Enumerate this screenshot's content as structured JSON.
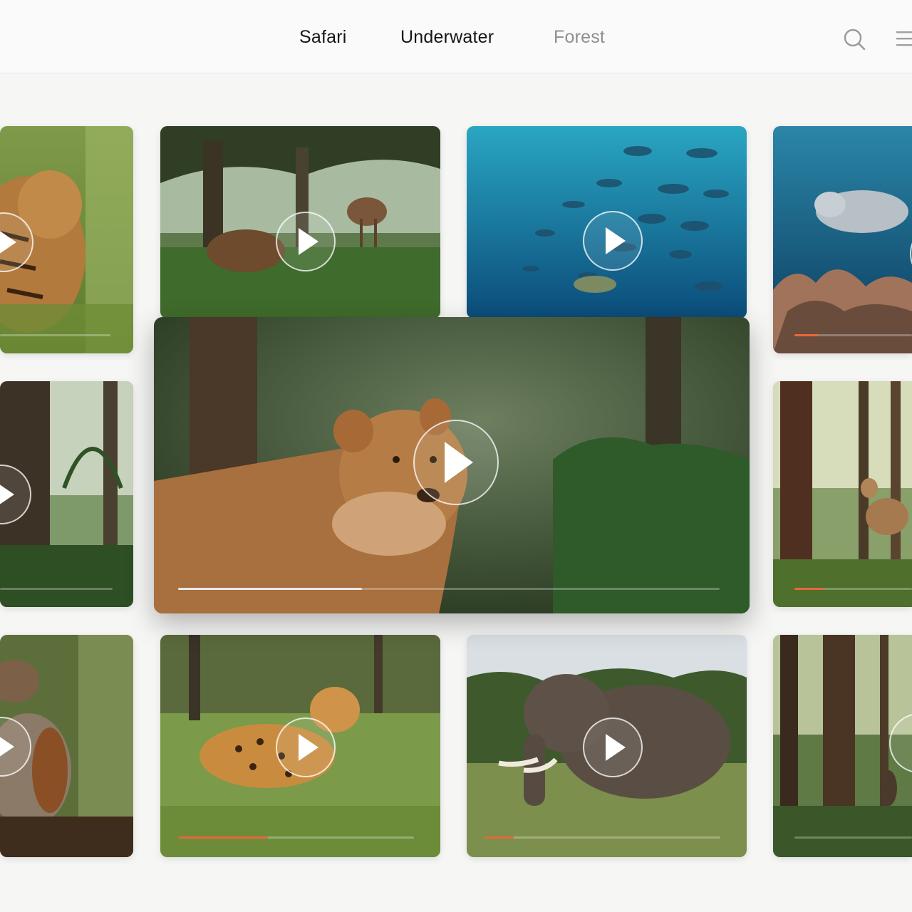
{
  "nav": {
    "tabs": [
      {
        "label": "Safari",
        "active": true
      },
      {
        "label": "Underwater",
        "active": true
      },
      {
        "label": "Forest",
        "active": false
      }
    ],
    "icons": {
      "search": "search-icon",
      "menu": "menu-icon"
    }
  },
  "colors": {
    "accent": "#e8673a",
    "active_tab": "#151515",
    "inactive_tab": "#8f8f8f",
    "page_background": "#f6f6f5"
  },
  "cards": [
    {
      "id": "leopard-grass",
      "scene": "tiger-grass",
      "progress": 0
    },
    {
      "id": "deer-forest",
      "scene": "deer-forest",
      "progress": 0
    },
    {
      "id": "fish-school",
      "scene": "fish-school",
      "progress": 0
    },
    {
      "id": "seal-reef",
      "scene": "seal-reef",
      "progress": 0.16
    },
    {
      "id": "lioness-forest",
      "scene": "lioness-forest",
      "featured": true,
      "progress": 0.34
    },
    {
      "id": "tall-trees",
      "scene": "tall-trees",
      "progress": 0
    },
    {
      "id": "deer-woods",
      "scene": "deer-woods",
      "progress": 0.25
    },
    {
      "id": "monkey",
      "scene": "monkey",
      "progress": 0
    },
    {
      "id": "leopard-walk",
      "scene": "leopard-walk",
      "progress": 0.38
    },
    {
      "id": "elephant",
      "scene": "elephant",
      "progress": 0.12
    },
    {
      "id": "forest-bird",
      "scene": "forest-bird",
      "progress": 0
    }
  ]
}
